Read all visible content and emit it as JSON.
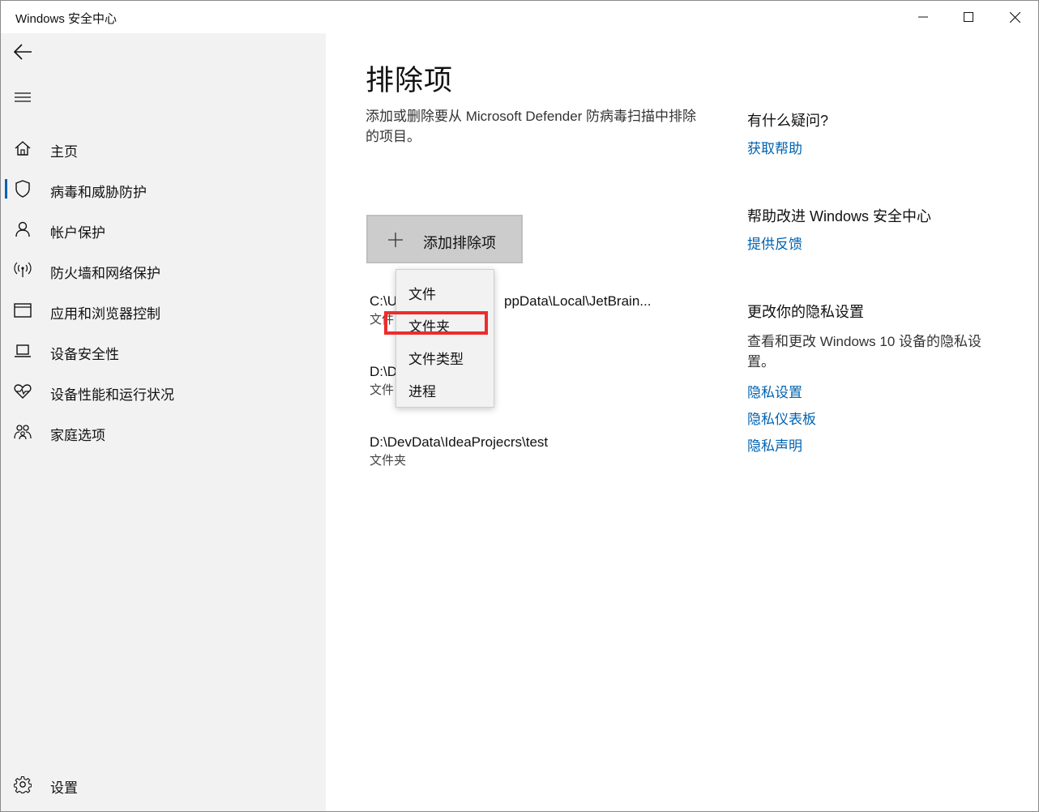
{
  "window": {
    "title": "Windows 安全中心",
    "controls": {
      "minimize_icon": "minimize-icon",
      "maximize_icon": "maximize-icon",
      "close_icon": "close-icon"
    }
  },
  "sidebar": {
    "back_icon": "back-arrow-icon",
    "menu_icon": "hamburger-menu-icon",
    "items": [
      {
        "label": "主页",
        "icon": "home-icon",
        "active": false
      },
      {
        "label": "病毒和威胁防护",
        "icon": "shield-icon",
        "active": true
      },
      {
        "label": "帐户保护",
        "icon": "person-icon",
        "active": false
      },
      {
        "label": "防火墙和网络保护",
        "icon": "wifi-antenna-icon",
        "active": false
      },
      {
        "label": "应用和浏览器控制",
        "icon": "browser-window-icon",
        "active": false
      },
      {
        "label": "设备安全性",
        "icon": "laptop-icon",
        "active": false
      },
      {
        "label": "设备性能和运行状况",
        "icon": "heart-pulse-icon",
        "active": false
      },
      {
        "label": "家庭选项",
        "icon": "family-icon",
        "active": false
      }
    ],
    "settings": {
      "label": "设置",
      "icon": "gear-icon"
    }
  },
  "main": {
    "title": "排除项",
    "description": "添加或删除要从 Microsoft Defender 防病毒扫描中排除的项目。",
    "add_button": {
      "label": "添加排除项",
      "icon": "plus-icon"
    },
    "exclusions": [
      {
        "path": "C:\\U",
        "path_suffix": "ppData\\Local\\JetBrain...",
        "type": "文件"
      },
      {
        "path": "D:\\D",
        "path_suffix": "",
        "type": "文件"
      },
      {
        "path": "D:\\DevData\\IdeaProjecrs\\test",
        "path_suffix": "",
        "type": "文件夹"
      }
    ]
  },
  "dropdown": {
    "items": [
      "文件",
      "文件夹",
      "文件类型",
      "进程"
    ],
    "highlighted_index": 1,
    "highlight_color": "#ee2c2c"
  },
  "right": {
    "question_heading": "有什么疑问?",
    "get_help_link": "获取帮助",
    "improve_heading": "帮助改进 Windows 安全中心",
    "feedback_link": "提供反馈",
    "privacy_heading": "更改你的隐私设置",
    "privacy_desc": "查看和更改 Windows 10 设备的隐私设置。",
    "privacy_settings_link": "隐私设置",
    "privacy_dashboard_link": "隐私仪表板",
    "privacy_statement_link": "隐私声明"
  },
  "colors": {
    "accent": "#0063b1",
    "sidebar_bg": "#f2f2f2",
    "button_bg": "#cccccc"
  }
}
